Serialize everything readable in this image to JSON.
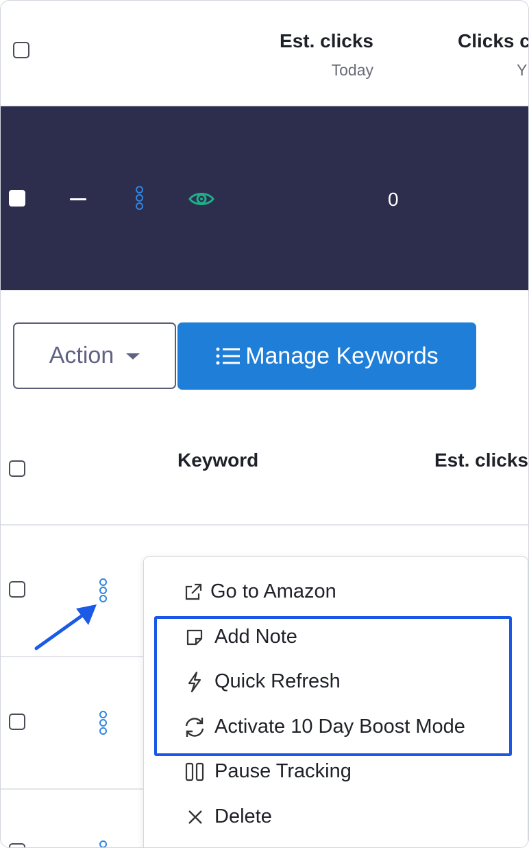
{
  "top_header": {
    "col1_title": "Est. clicks",
    "col1_sub": "Today",
    "col2_title": "Clicks c",
    "col2_sub": "Y"
  },
  "active_row": {
    "dash": "—",
    "value": "0"
  },
  "toolbar": {
    "action_label": "Action",
    "manage_label": "Manage Keywords"
  },
  "keyword_header": {
    "keyword": "Keyword",
    "est_clicks": "Est. clicks"
  },
  "context_menu": {
    "items": [
      {
        "label": "Go to Amazon",
        "icon": "external-link-icon"
      },
      {
        "label": "Add Note",
        "icon": "note-icon"
      },
      {
        "label": "Quick Refresh",
        "icon": "lightning-icon"
      },
      {
        "label": "Activate 10 Day Boost Mode",
        "icon": "refresh-icon"
      },
      {
        "label": "Pause Tracking",
        "icon": "pause-icon"
      },
      {
        "label": "Delete",
        "icon": "close-icon"
      }
    ]
  },
  "colors": {
    "dark_row": "#2d2d4d",
    "primary": "#1f7ed8",
    "eye": "#1fae8a",
    "highlight": "#1a57e6",
    "arrow": "#1a5ae6"
  }
}
